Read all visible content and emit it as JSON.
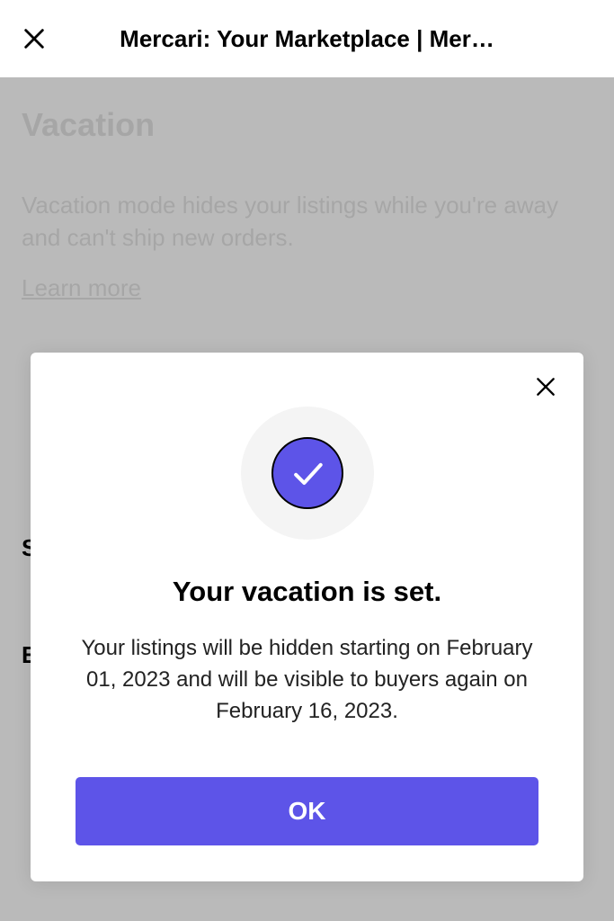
{
  "header": {
    "title": "Mercari: Your Marketplace | Mer…"
  },
  "page": {
    "heading": "Vacation",
    "description": "Vacation mode hides your listings while you're away and can't ship new orders.",
    "learn_more": "Learn more",
    "label_s": "S",
    "label_e": "E"
  },
  "modal": {
    "title": "Your vacation is set.",
    "body": "Your listings will be hidden starting on February 01, 2023 and will be visible to buyers again on February 16, 2023.",
    "ok_label": "OK"
  },
  "colors": {
    "accent": "#5d54e8"
  }
}
